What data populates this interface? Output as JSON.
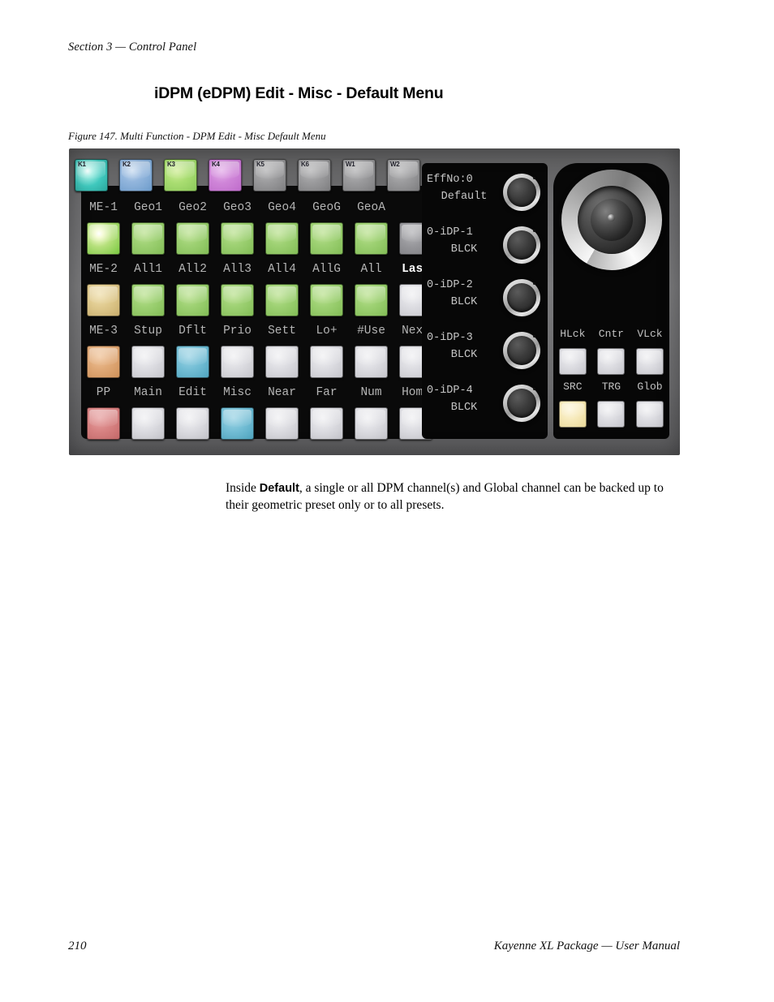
{
  "header": {
    "section": "Section 3 — Control Panel",
    "title": "iDPM (eDPM) Edit - Misc - Default Menu",
    "figure_caption": "Figure 147.  Multi Function - DPM Edit - Misc Default Menu"
  },
  "panel": {
    "keypad_top": [
      {
        "label": "K1",
        "color": "#3fc8bd",
        "state": "lit"
      },
      {
        "label": "K2",
        "color": "#6d9ccb",
        "state": "on"
      },
      {
        "label": "K3",
        "color": "#8cc95b",
        "state": "on"
      },
      {
        "label": "K4",
        "color": "#bf6ccb",
        "state": "on"
      },
      {
        "label": "K5",
        "color": "#7e7e80",
        "state": "off"
      },
      {
        "label": "K6",
        "color": "#7e7e80",
        "state": "off"
      },
      {
        "label": "W1",
        "color": "#7e7e80",
        "state": "off"
      },
      {
        "label": "W2",
        "color": "#7e7e80",
        "state": "off"
      }
    ],
    "rows": [
      {
        "labels": [
          "ME-1",
          "Geo1",
          "Geo2",
          "Geo3",
          "Geo4",
          "GeoG",
          "GeoA",
          ""
        ],
        "highlight": [],
        "buttons": [
          "green-lit",
          "green",
          "green",
          "green",
          "green",
          "green",
          "green",
          "gray"
        ]
      },
      {
        "labels": [
          "ME-2",
          "All1",
          "All2",
          "All3",
          "All4",
          "AllG",
          "All",
          "Last"
        ],
        "highlight": [
          7
        ],
        "buttons": [
          "tan",
          "green",
          "green",
          "green",
          "green",
          "green",
          "green",
          "white"
        ]
      },
      {
        "labels": [
          "ME-3",
          "Stup",
          "Dflt",
          "Prio",
          "Sett",
          "Lo+",
          "#Use",
          "Next"
        ],
        "highlight": [],
        "buttons": [
          "orange",
          "white",
          "cyan",
          "white",
          "white",
          "white",
          "white",
          "white"
        ]
      },
      {
        "labels": [
          "PP",
          "Main",
          "Edit",
          "Misc",
          "Near",
          "Far",
          "Num",
          "Home"
        ],
        "highlight": [],
        "buttons": [
          "red",
          "white",
          "white",
          "cyan",
          "white",
          "white",
          "white",
          "white"
        ]
      }
    ],
    "knobs": [
      {
        "line1": "EffNo:0",
        "line2": "Default"
      },
      {
        "line1": "0-iDP-1",
        "line2": "BLCK"
      },
      {
        "line1": "0-iDP-2",
        "line2": "BLCK"
      },
      {
        "line1": "0-iDP-3",
        "line2": "BLCK"
      },
      {
        "line1": "0-iDP-4",
        "line2": "BLCK"
      }
    ],
    "joystick": {
      "icon": "joystick-icon",
      "lock_labels": [
        "HLck",
        "Cntr",
        "VLck"
      ],
      "lock_buttons": [
        "white",
        "white",
        "white"
      ],
      "source_labels": [
        "SRC",
        "TRG",
        "Glob"
      ],
      "source_buttons": [
        "cream",
        "white",
        "white"
      ]
    }
  },
  "body": {
    "pre": "Inside ",
    "bold": "Default",
    "post": ", a single or all DPM channel(s) and Global channel can be backed up to their geometric preset only or to all presets."
  },
  "footer": {
    "page_number": "210",
    "manual": "Kayenne XL Package  —  User Manual"
  }
}
